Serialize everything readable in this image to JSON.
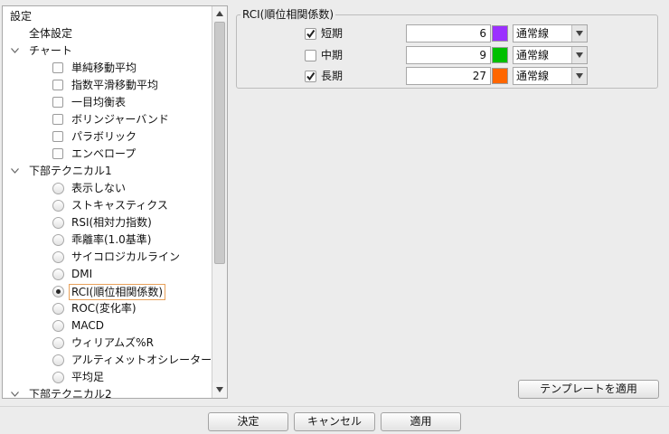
{
  "tree": {
    "items": [
      {
        "label": "設定",
        "level": 0,
        "control": "none"
      },
      {
        "label": "全体設定",
        "level": 1,
        "control": "none"
      },
      {
        "label": "チャート",
        "level": 1,
        "control": "expander"
      },
      {
        "label": "単純移動平均",
        "level": 2,
        "control": "checkbox",
        "checked": false
      },
      {
        "label": "指数平滑移動平均",
        "level": 2,
        "control": "checkbox",
        "checked": false
      },
      {
        "label": "一目均衡表",
        "level": 2,
        "control": "checkbox",
        "checked": false
      },
      {
        "label": "ボリンジャーバンド",
        "level": 2,
        "control": "checkbox",
        "checked": false
      },
      {
        "label": "パラボリック",
        "level": 2,
        "control": "checkbox",
        "checked": false
      },
      {
        "label": "エンベロープ",
        "level": 2,
        "control": "checkbox",
        "checked": false
      },
      {
        "label": "下部テクニカル1",
        "level": 1,
        "control": "expander"
      },
      {
        "label": "表示しない",
        "level": 2,
        "control": "radio",
        "checked": false
      },
      {
        "label": "ストキャスティクス",
        "level": 2,
        "control": "radio",
        "checked": false
      },
      {
        "label": "RSI(相対力指数)",
        "level": 2,
        "control": "radio",
        "checked": false
      },
      {
        "label": "乖離率(1.0基準)",
        "level": 2,
        "control": "radio",
        "checked": false
      },
      {
        "label": "サイコロジカルライン",
        "level": 2,
        "control": "radio",
        "checked": false
      },
      {
        "label": "DMI",
        "level": 2,
        "control": "radio",
        "checked": false
      },
      {
        "label": "RCI(順位相関係数)",
        "level": 2,
        "control": "radio",
        "checked": true
      },
      {
        "label": "ROC(変化率)",
        "level": 2,
        "control": "radio",
        "checked": false
      },
      {
        "label": "MACD",
        "level": 2,
        "control": "radio",
        "checked": false
      },
      {
        "label": "ウィリアムズ%R",
        "level": 2,
        "control": "radio",
        "checked": false
      },
      {
        "label": "アルティメットオシレーター",
        "level": 2,
        "control": "radio",
        "checked": false
      },
      {
        "label": "平均足",
        "level": 2,
        "control": "radio",
        "checked": false
      },
      {
        "label": "下部テクニカル2",
        "level": 1,
        "control": "expander"
      }
    ]
  },
  "rci_group": {
    "title": "RCI(順位相関係数)",
    "rows": [
      {
        "label": "短期",
        "checked": true,
        "value": "6",
        "color": "#9b30ff",
        "line_type": "通常線"
      },
      {
        "label": "中期",
        "checked": false,
        "value": "9",
        "color": "#00c000",
        "line_type": "通常線"
      },
      {
        "label": "長期",
        "checked": true,
        "value": "27",
        "color": "#ff6600",
        "line_type": "通常線"
      }
    ]
  },
  "buttons": {
    "apply_template": "テンプレートを適用",
    "ok": "決定",
    "cancel": "キャンセル",
    "apply": "適用"
  }
}
